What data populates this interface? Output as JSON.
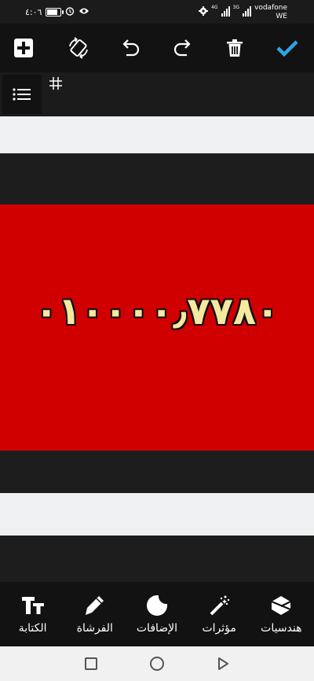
{
  "status_bar": {
    "time": "٤:٠٦",
    "battery_level": 0.85,
    "carrier": "vodafone",
    "carrier_sub": "WE",
    "net_tag_1": "4G",
    "net_tag_2": "3G"
  },
  "toolbar": {
    "icons": [
      "add-icon",
      "rotate-device-icon",
      "undo-icon",
      "redo-icon",
      "delete-icon",
      "checkmark-icon"
    ],
    "accent_color": "#2fa3e6"
  },
  "sub_bar": {
    "icons": [
      "list-icon",
      "grid-icon"
    ]
  },
  "canvas": {
    "phone_number": "٠١٠٠٠٠٫٧٧٨٠",
    "banner_color": "#d00000",
    "text_color": "#f5e9a0"
  },
  "bottom_tools": [
    {
      "id": "geometry",
      "label": "هندسيات",
      "icon": "cube-icon"
    },
    {
      "id": "effects",
      "label": "مؤثرات",
      "icon": "magic-wand-icon"
    },
    {
      "id": "addons",
      "label": "الإضافات",
      "icon": "sticker-icon"
    },
    {
      "id": "brush",
      "label": "الفرشاة",
      "icon": "pencil-icon"
    },
    {
      "id": "text",
      "label": "الكتابة",
      "icon": "text-size-icon"
    }
  ],
  "android_nav": {
    "icons": [
      "recents-icon",
      "home-icon",
      "back-icon"
    ]
  }
}
